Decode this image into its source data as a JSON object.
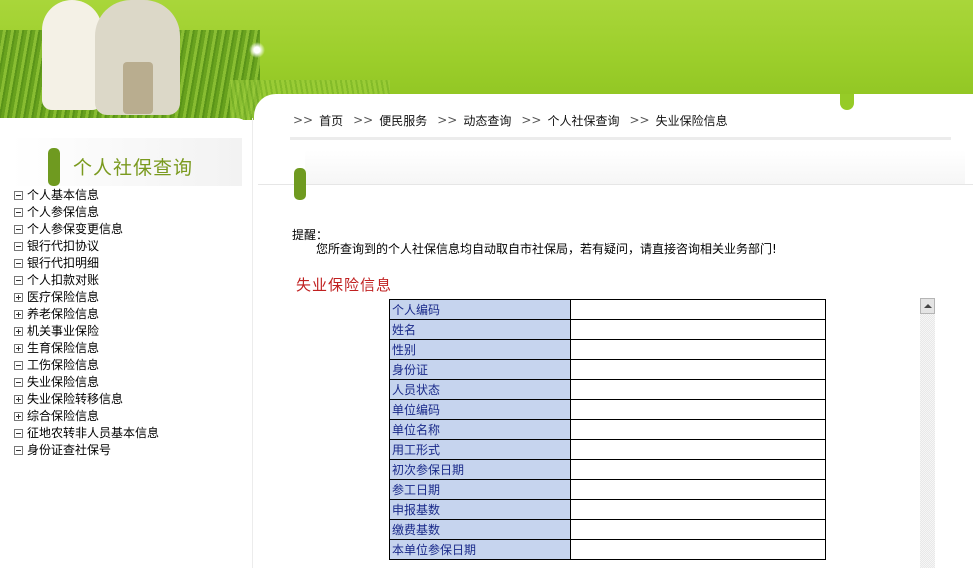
{
  "breadcrumb": {
    "separator": ">>",
    "items": [
      "首页",
      "便民服务",
      "动态查询",
      "个人社保查询"
    ],
    "current": "失业保险信息"
  },
  "sidebar": {
    "title": "个人社保查询",
    "items": [
      {
        "label": "个人基本信息",
        "toggle": "minus"
      },
      {
        "label": "个人参保信息",
        "toggle": "minus"
      },
      {
        "label": "个人参保变更信息",
        "toggle": "minus"
      },
      {
        "label": "银行代扣协议",
        "toggle": "minus"
      },
      {
        "label": "银行代扣明细",
        "toggle": "minus"
      },
      {
        "label": "个人扣款对账",
        "toggle": "minus"
      },
      {
        "label": "医疗保险信息",
        "toggle": "plus"
      },
      {
        "label": "养老保险信息",
        "toggle": "plus"
      },
      {
        "label": "机关事业保险",
        "toggle": "plus"
      },
      {
        "label": "生育保险信息",
        "toggle": "plus"
      },
      {
        "label": "工伤保险信息",
        "toggle": "minus"
      },
      {
        "label": "失业保险信息",
        "toggle": "minus"
      },
      {
        "label": "失业保险转移信息",
        "toggle": "plus"
      },
      {
        "label": "综合保险信息",
        "toggle": "plus"
      },
      {
        "label": "征地农转非人员基本信息",
        "toggle": "minus"
      },
      {
        "label": "身份证查社保号",
        "toggle": "minus"
      }
    ]
  },
  "notice": {
    "title": "提醒：",
    "body": "您所查询到的个人社保信息均自动取自市社保局，若有疑问，请直接咨询相关业务部门!"
  },
  "page_heading": "失业保险信息",
  "info_table": {
    "rows": [
      {
        "label": "个人编码",
        "value": ""
      },
      {
        "label": "姓名",
        "value": ""
      },
      {
        "label": "性别",
        "value": ""
      },
      {
        "label": "身份证",
        "value": ""
      },
      {
        "label": "人员状态",
        "value": ""
      },
      {
        "label": "单位编码",
        "value": ""
      },
      {
        "label": "单位名称",
        "value": ""
      },
      {
        "label": "用工形式",
        "value": ""
      },
      {
        "label": "初次参保日期",
        "value": ""
      },
      {
        "label": "参工日期",
        "value": ""
      },
      {
        "label": "申报基数",
        "value": ""
      },
      {
        "label": "缴费基数",
        "value": ""
      },
      {
        "label": "本单位参保日期",
        "value": ""
      }
    ]
  },
  "colors": {
    "banner_green": "#9dcf2c",
    "accent_bar": "#6f9a20",
    "sidebar_title": "#7a9a1e",
    "heading_red": "#c02020",
    "label_cell_bg": "#c6d4ee",
    "label_text": "#1a2a8a"
  }
}
